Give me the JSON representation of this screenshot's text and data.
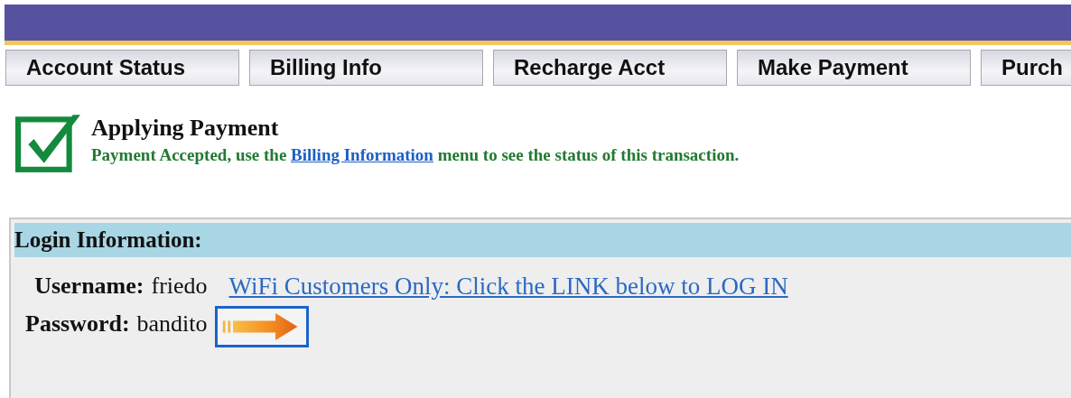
{
  "tabs": [
    {
      "label": "Account Status"
    },
    {
      "label": "Billing Info"
    },
    {
      "label": "Recharge Acct"
    },
    {
      "label": "Make Payment"
    },
    {
      "label": "Purch"
    }
  ],
  "status": {
    "title": "Applying Payment",
    "message_before": "Payment Accepted, use the",
    "link": "Billing Information",
    "message_after": "menu to see the status of this transaction."
  },
  "login_panel": {
    "title": "Login Information:",
    "fields": [
      {
        "label": "Username:",
        "value": "friedo"
      },
      {
        "label": "Password:",
        "value": "bandito"
      }
    ],
    "wifi_link": "WiFi Customers Only: Click the LINK below to LOG IN"
  }
}
